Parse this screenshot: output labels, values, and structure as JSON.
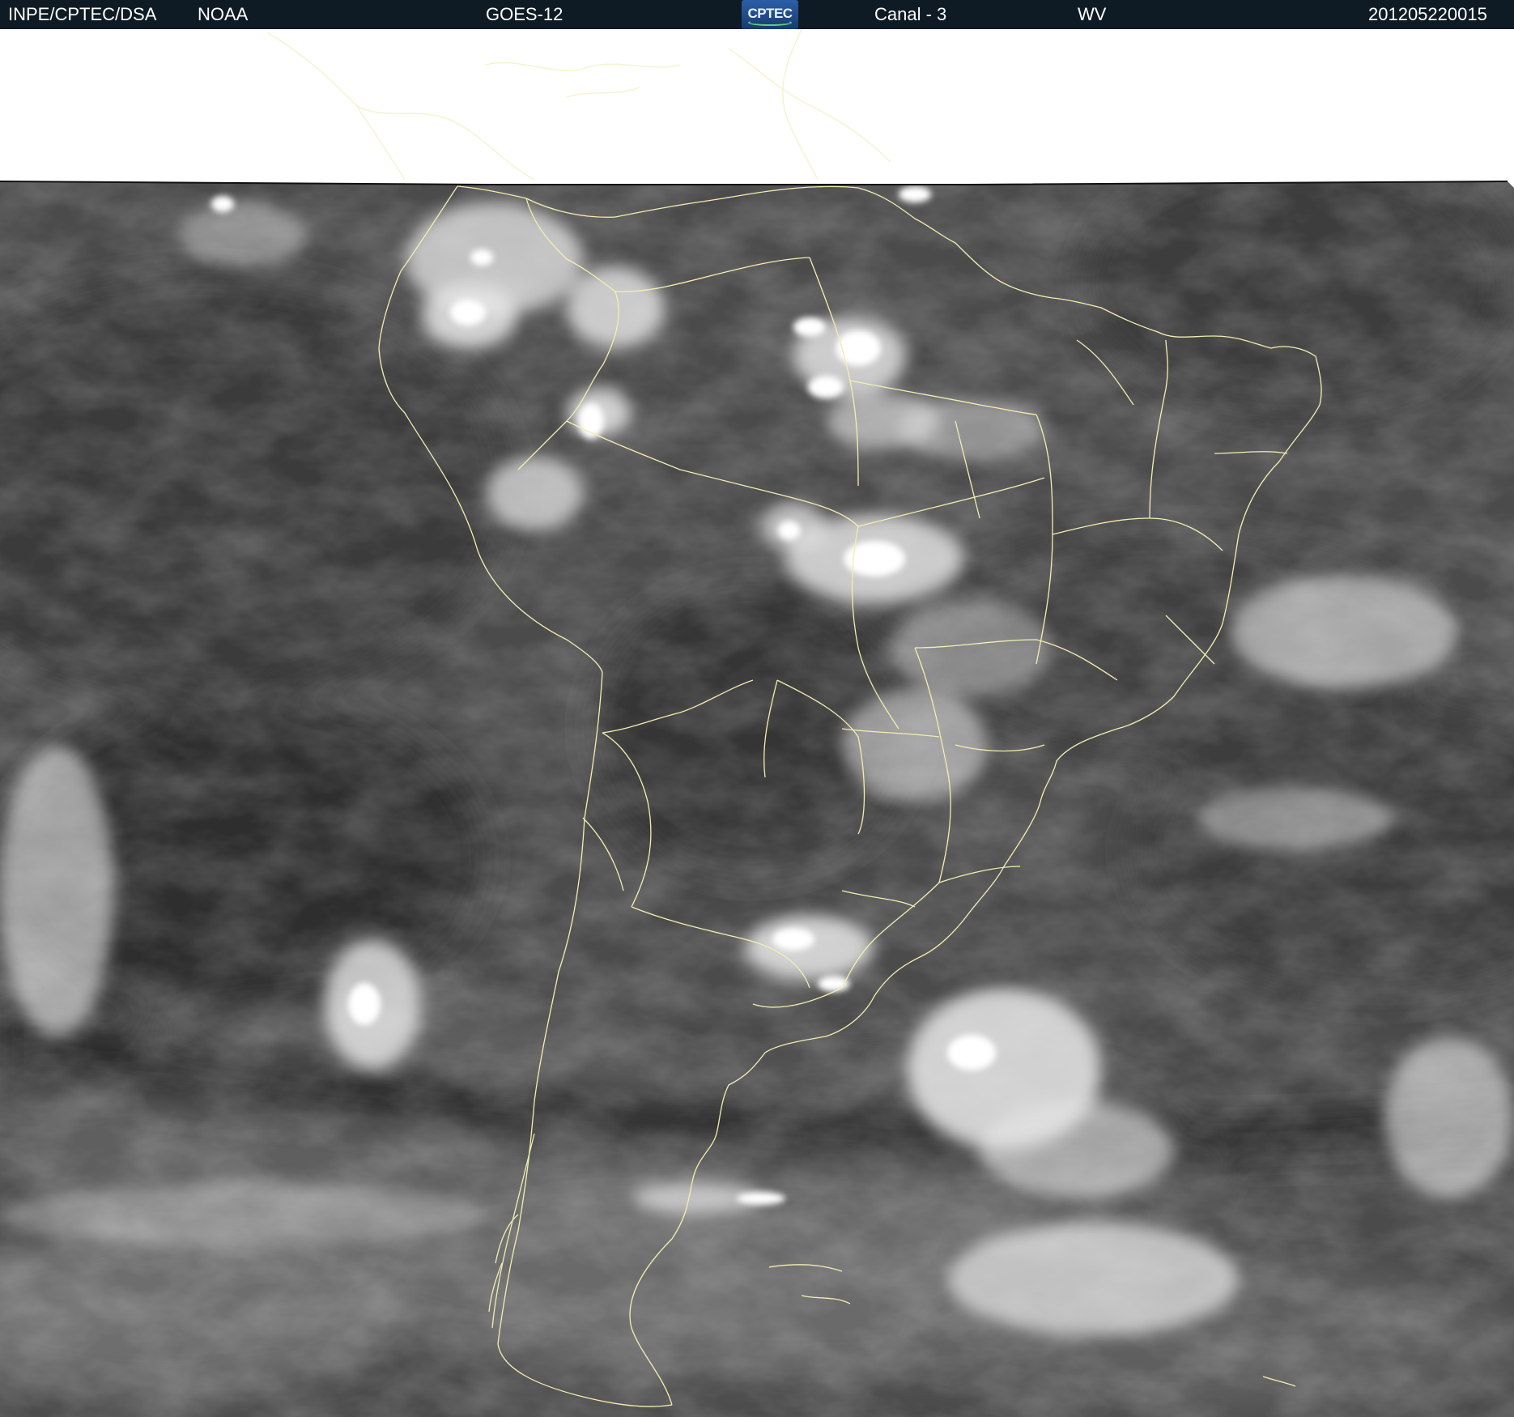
{
  "header": {
    "institution": "INPE/CPTEC/DSA",
    "agency": "NOAA",
    "satellite": "GOES-12",
    "logo_text": "CPTEC",
    "channel": "Canal - 3",
    "band": "WV",
    "timestamp": "201205220015"
  },
  "image": {
    "type": "water-vapor satellite image",
    "region": "South America",
    "colors": {
      "header_bg": "#0f1b24",
      "header_text": "#ffffff",
      "borders": "#f2efb0",
      "cloud_high": "#ffffff",
      "background_dark": "#3a3a3a"
    }
  }
}
